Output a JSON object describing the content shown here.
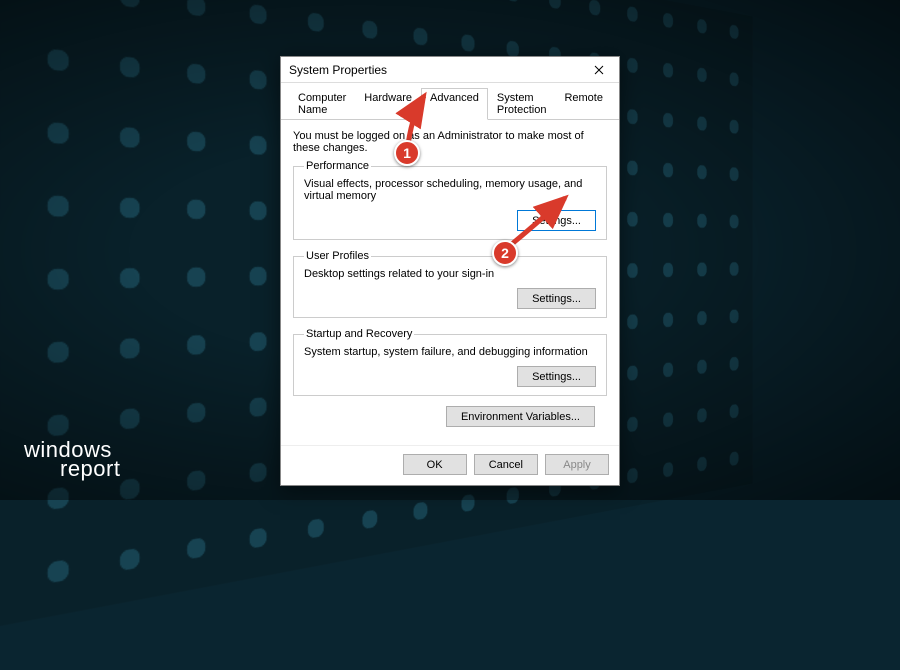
{
  "watermark": {
    "line1": "windows",
    "line2": "report"
  },
  "dialog": {
    "title": "System Properties",
    "tabs": [
      {
        "label": "Computer Name"
      },
      {
        "label": "Hardware"
      },
      {
        "label": "Advanced"
      },
      {
        "label": "System Protection"
      },
      {
        "label": "Remote"
      }
    ],
    "active_tab": 2,
    "admin_note": "You must be logged on as an Administrator to make most of these changes.",
    "groups": {
      "performance": {
        "legend": "Performance",
        "desc": "Visual effects, processor scheduling, memory usage, and virtual memory",
        "button": "Settings..."
      },
      "user_profiles": {
        "legend": "User Profiles",
        "desc": "Desktop settings related to your sign-in",
        "button": "Settings..."
      },
      "startup": {
        "legend": "Startup and Recovery",
        "desc": "System startup, system failure, and debugging information",
        "button": "Settings..."
      }
    },
    "env_vars_button": "Environment Variables...",
    "footer": {
      "ok": "OK",
      "cancel": "Cancel",
      "apply": "Apply"
    }
  },
  "annotations": {
    "badge1": "1",
    "badge2": "2"
  }
}
